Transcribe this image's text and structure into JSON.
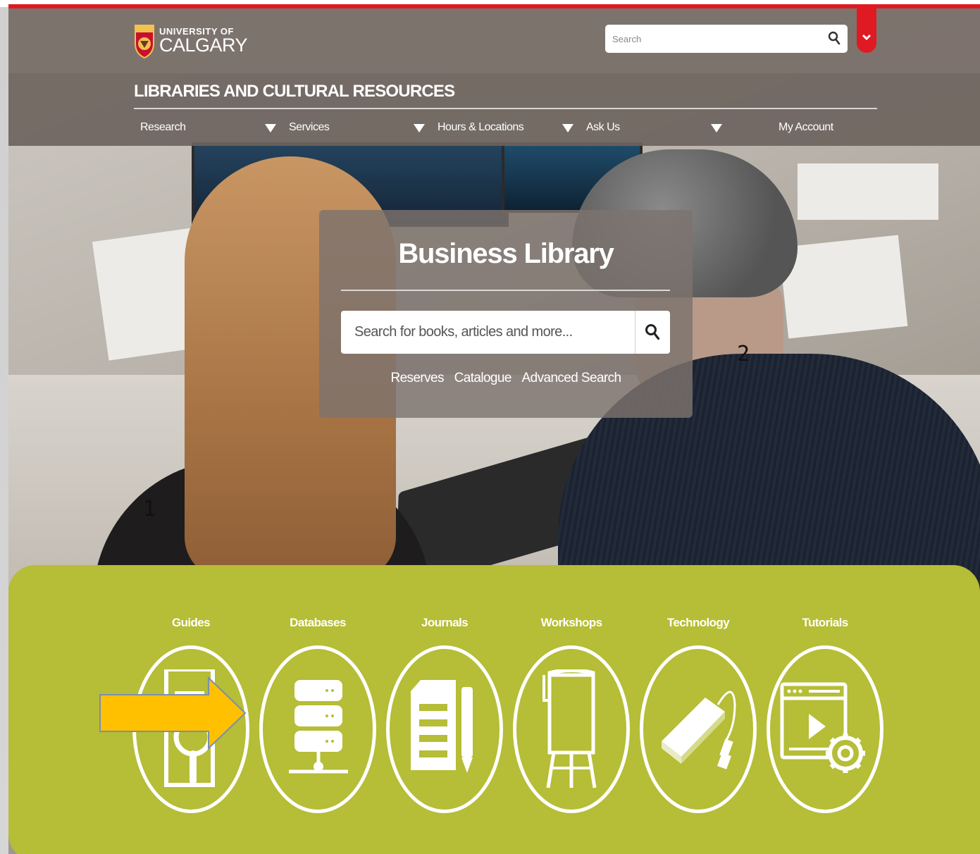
{
  "header": {
    "logo_line1": "UNIVERSITY OF",
    "logo_line2": "CALGARY",
    "search_placeholder": "Search",
    "site_title": "LIBRARIES AND CULTURAL RESOURCES"
  },
  "nav": {
    "items": [
      {
        "label": "Research"
      },
      {
        "label": "Services"
      },
      {
        "label": "Hours & Locations"
      },
      {
        "label": "Ask Us"
      },
      {
        "label": "My Account"
      }
    ]
  },
  "hero": {
    "title": "Business Library",
    "search_placeholder": "Search for books, articles and more...",
    "links": [
      {
        "label": "Reserves"
      },
      {
        "label": "Catalogue"
      },
      {
        "label": "Advanced Search"
      }
    ]
  },
  "markers": {
    "m1": "1",
    "m2": "2"
  },
  "resources": {
    "items": [
      {
        "label": "Guides",
        "icon": "guide-magnifier-icon"
      },
      {
        "label": "Databases",
        "icon": "database-server-icon"
      },
      {
        "label": "Journals",
        "icon": "journal-pen-icon"
      },
      {
        "label": "Workshops",
        "icon": "flipchart-easel-icon"
      },
      {
        "label": "Technology",
        "icon": "hard-drive-icon"
      },
      {
        "label": "Tutorials",
        "icon": "video-tutorial-gear-icon"
      }
    ]
  },
  "colors": {
    "brand_red": "#e01a22",
    "header_bg": "#6e645e",
    "green_panel": "#b6bd36",
    "arrow_fill": "#ffc000"
  }
}
